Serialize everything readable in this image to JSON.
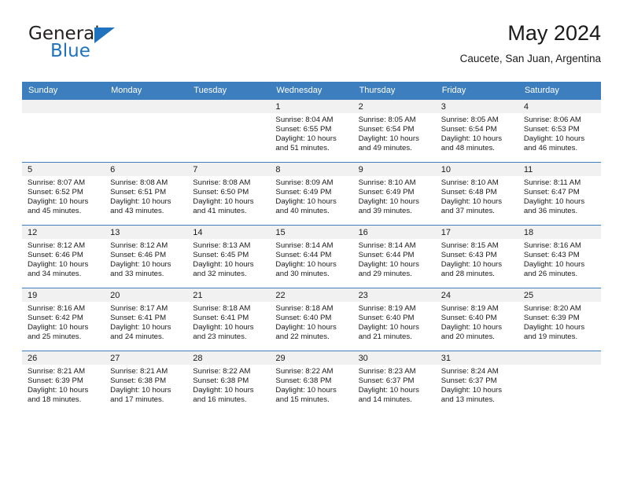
{
  "brand": {
    "name_top": "General",
    "name_bottom": "Blue",
    "color_blue": "#1f72bd",
    "color_dark": "#231f20"
  },
  "header": {
    "title": "May 2024",
    "subtitle": "Caucete, San Juan, Argentina"
  },
  "theme": {
    "header_blue": "#3d7ebf",
    "daynum_band": "#f1f1f1",
    "text": "#1a1a1a"
  },
  "weekdays": [
    "Sunday",
    "Monday",
    "Tuesday",
    "Wednesday",
    "Thursday",
    "Friday",
    "Saturday"
  ],
  "weeks": [
    [
      {
        "day": "",
        "sunrise": "",
        "sunset": "",
        "daylight_1": "",
        "daylight_2": ""
      },
      {
        "day": "",
        "sunrise": "",
        "sunset": "",
        "daylight_1": "",
        "daylight_2": ""
      },
      {
        "day": "",
        "sunrise": "",
        "sunset": "",
        "daylight_1": "",
        "daylight_2": ""
      },
      {
        "day": "1",
        "sunrise": "Sunrise: 8:04 AM",
        "sunset": "Sunset: 6:55 PM",
        "daylight_1": "Daylight: 10 hours",
        "daylight_2": "and 51 minutes."
      },
      {
        "day": "2",
        "sunrise": "Sunrise: 8:05 AM",
        "sunset": "Sunset: 6:54 PM",
        "daylight_1": "Daylight: 10 hours",
        "daylight_2": "and 49 minutes."
      },
      {
        "day": "3",
        "sunrise": "Sunrise: 8:05 AM",
        "sunset": "Sunset: 6:54 PM",
        "daylight_1": "Daylight: 10 hours",
        "daylight_2": "and 48 minutes."
      },
      {
        "day": "4",
        "sunrise": "Sunrise: 8:06 AM",
        "sunset": "Sunset: 6:53 PM",
        "daylight_1": "Daylight: 10 hours",
        "daylight_2": "and 46 minutes."
      }
    ],
    [
      {
        "day": "5",
        "sunrise": "Sunrise: 8:07 AM",
        "sunset": "Sunset: 6:52 PM",
        "daylight_1": "Daylight: 10 hours",
        "daylight_2": "and 45 minutes."
      },
      {
        "day": "6",
        "sunrise": "Sunrise: 8:08 AM",
        "sunset": "Sunset: 6:51 PM",
        "daylight_1": "Daylight: 10 hours",
        "daylight_2": "and 43 minutes."
      },
      {
        "day": "7",
        "sunrise": "Sunrise: 8:08 AM",
        "sunset": "Sunset: 6:50 PM",
        "daylight_1": "Daylight: 10 hours",
        "daylight_2": "and 41 minutes."
      },
      {
        "day": "8",
        "sunrise": "Sunrise: 8:09 AM",
        "sunset": "Sunset: 6:49 PM",
        "daylight_1": "Daylight: 10 hours",
        "daylight_2": "and 40 minutes."
      },
      {
        "day": "9",
        "sunrise": "Sunrise: 8:10 AM",
        "sunset": "Sunset: 6:49 PM",
        "daylight_1": "Daylight: 10 hours",
        "daylight_2": "and 39 minutes."
      },
      {
        "day": "10",
        "sunrise": "Sunrise: 8:10 AM",
        "sunset": "Sunset: 6:48 PM",
        "daylight_1": "Daylight: 10 hours",
        "daylight_2": "and 37 minutes."
      },
      {
        "day": "11",
        "sunrise": "Sunrise: 8:11 AM",
        "sunset": "Sunset: 6:47 PM",
        "daylight_1": "Daylight: 10 hours",
        "daylight_2": "and 36 minutes."
      }
    ],
    [
      {
        "day": "12",
        "sunrise": "Sunrise: 8:12 AM",
        "sunset": "Sunset: 6:46 PM",
        "daylight_1": "Daylight: 10 hours",
        "daylight_2": "and 34 minutes."
      },
      {
        "day": "13",
        "sunrise": "Sunrise: 8:12 AM",
        "sunset": "Sunset: 6:46 PM",
        "daylight_1": "Daylight: 10 hours",
        "daylight_2": "and 33 minutes."
      },
      {
        "day": "14",
        "sunrise": "Sunrise: 8:13 AM",
        "sunset": "Sunset: 6:45 PM",
        "daylight_1": "Daylight: 10 hours",
        "daylight_2": "and 32 minutes."
      },
      {
        "day": "15",
        "sunrise": "Sunrise: 8:14 AM",
        "sunset": "Sunset: 6:44 PM",
        "daylight_1": "Daylight: 10 hours",
        "daylight_2": "and 30 minutes."
      },
      {
        "day": "16",
        "sunrise": "Sunrise: 8:14 AM",
        "sunset": "Sunset: 6:44 PM",
        "daylight_1": "Daylight: 10 hours",
        "daylight_2": "and 29 minutes."
      },
      {
        "day": "17",
        "sunrise": "Sunrise: 8:15 AM",
        "sunset": "Sunset: 6:43 PM",
        "daylight_1": "Daylight: 10 hours",
        "daylight_2": "and 28 minutes."
      },
      {
        "day": "18",
        "sunrise": "Sunrise: 8:16 AM",
        "sunset": "Sunset: 6:43 PM",
        "daylight_1": "Daylight: 10 hours",
        "daylight_2": "and 26 minutes."
      }
    ],
    [
      {
        "day": "19",
        "sunrise": "Sunrise: 8:16 AM",
        "sunset": "Sunset: 6:42 PM",
        "daylight_1": "Daylight: 10 hours",
        "daylight_2": "and 25 minutes."
      },
      {
        "day": "20",
        "sunrise": "Sunrise: 8:17 AM",
        "sunset": "Sunset: 6:41 PM",
        "daylight_1": "Daylight: 10 hours",
        "daylight_2": "and 24 minutes."
      },
      {
        "day": "21",
        "sunrise": "Sunrise: 8:18 AM",
        "sunset": "Sunset: 6:41 PM",
        "daylight_1": "Daylight: 10 hours",
        "daylight_2": "and 23 minutes."
      },
      {
        "day": "22",
        "sunrise": "Sunrise: 8:18 AM",
        "sunset": "Sunset: 6:40 PM",
        "daylight_1": "Daylight: 10 hours",
        "daylight_2": "and 22 minutes."
      },
      {
        "day": "23",
        "sunrise": "Sunrise: 8:19 AM",
        "sunset": "Sunset: 6:40 PM",
        "daylight_1": "Daylight: 10 hours",
        "daylight_2": "and 21 minutes."
      },
      {
        "day": "24",
        "sunrise": "Sunrise: 8:19 AM",
        "sunset": "Sunset: 6:40 PM",
        "daylight_1": "Daylight: 10 hours",
        "daylight_2": "and 20 minutes."
      },
      {
        "day": "25",
        "sunrise": "Sunrise: 8:20 AM",
        "sunset": "Sunset: 6:39 PM",
        "daylight_1": "Daylight: 10 hours",
        "daylight_2": "and 19 minutes."
      }
    ],
    [
      {
        "day": "26",
        "sunrise": "Sunrise: 8:21 AM",
        "sunset": "Sunset: 6:39 PM",
        "daylight_1": "Daylight: 10 hours",
        "daylight_2": "and 18 minutes."
      },
      {
        "day": "27",
        "sunrise": "Sunrise: 8:21 AM",
        "sunset": "Sunset: 6:38 PM",
        "daylight_1": "Daylight: 10 hours",
        "daylight_2": "and 17 minutes."
      },
      {
        "day": "28",
        "sunrise": "Sunrise: 8:22 AM",
        "sunset": "Sunset: 6:38 PM",
        "daylight_1": "Daylight: 10 hours",
        "daylight_2": "and 16 minutes."
      },
      {
        "day": "29",
        "sunrise": "Sunrise: 8:22 AM",
        "sunset": "Sunset: 6:38 PM",
        "daylight_1": "Daylight: 10 hours",
        "daylight_2": "and 15 minutes."
      },
      {
        "day": "30",
        "sunrise": "Sunrise: 8:23 AM",
        "sunset": "Sunset: 6:37 PM",
        "daylight_1": "Daylight: 10 hours",
        "daylight_2": "and 14 minutes."
      },
      {
        "day": "31",
        "sunrise": "Sunrise: 8:24 AM",
        "sunset": "Sunset: 6:37 PM",
        "daylight_1": "Daylight: 10 hours",
        "daylight_2": "and 13 minutes."
      },
      {
        "day": "",
        "sunrise": "",
        "sunset": "",
        "daylight_1": "",
        "daylight_2": ""
      }
    ]
  ]
}
